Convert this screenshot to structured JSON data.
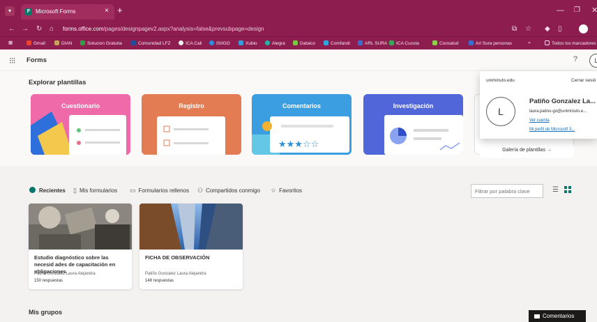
{
  "browser": {
    "tab_title": "Microsoft Forms",
    "tab_close": "×",
    "new_tab": "+",
    "url_host": "forms.office.com",
    "url_path": "/pages/designpagev2.aspx?analysis=false&prevsubpage=design",
    "bookmarks": [
      "Gmail",
      "DIAN",
      "Solucion Gratuita",
      "Comunidad LFZ",
      "ICA Cali",
      "ISIIGO",
      "Xubio",
      "Alegra",
      "Dataico",
      "Comfandi",
      "ARL SURA",
      "ICA Cucuta",
      "Coosalud",
      "Arl Sura personas",
      "»",
      "Todos los marcadores"
    ]
  },
  "app": {
    "name": "Forms",
    "help": "?",
    "avatar_letter": "L"
  },
  "templates": {
    "title": "Explorar plantillas",
    "cards": [
      {
        "label": "Cuestionario",
        "color": "#e85d9f"
      },
      {
        "label": "Registro",
        "color": "#e0754d"
      },
      {
        "label": "Comentarios",
        "color": "#2e8fd1"
      },
      {
        "label": "Investigación",
        "color": "#4f63d8"
      }
    ],
    "gallery_label": "Galería de plantillas →"
  },
  "account": {
    "org": "uniminuto.edu",
    "sign_out": "Cerrar sesió",
    "name": "Patiño Gonzalez La...",
    "email": "laura.patino-go@uniminuto.e...",
    "view_account": "Ver cuenta",
    "ms_profile": "Mi perfil de Microsoft 3..."
  },
  "filters": {
    "tabs": [
      "Recientes",
      "Mis formularios",
      "Formularios rellenos",
      "Compartidos conmigo",
      "Favoritos"
    ],
    "search_placeholder": "Filtrar por palabra clave"
  },
  "forms": [
    {
      "title": "Estudio diagnóstico sobre las necesid ades de capacitación en obligaciones",
      "owner": "Patiño Gonzalez Laura Alejandra",
      "responses": "150 respuestas"
    },
    {
      "title": "FICHA DE OBSERVACIÓN",
      "owner": "Patiño Gonzalez Laura Alejandra",
      "responses": "148 respuestas"
    }
  ],
  "groups_title": "Mis grupos",
  "feedback_label": "Comentarios"
}
